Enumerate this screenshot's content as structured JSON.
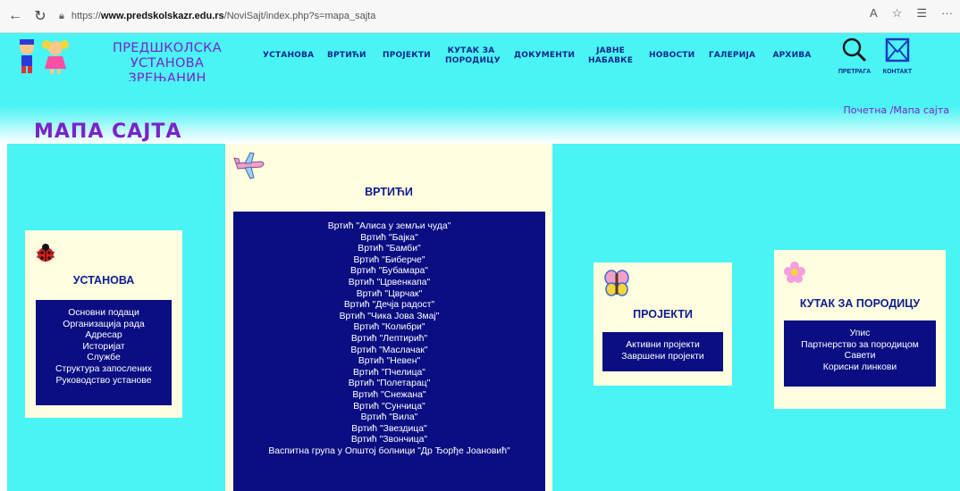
{
  "browser": {
    "url_prefix": "https://",
    "url_domain": "www.predskolskazr.edu.rs",
    "url_path": "/NoviSajt/index.php?s=mapa_sajta"
  },
  "header": {
    "brand_line1": "ПРЕДШКОЛСКА УСТАНОВА",
    "brand_line2": "ЗРЕЊАНИН",
    "menu": [
      {
        "line1": "УСТАНОВА",
        "line2": ""
      },
      {
        "line1": "ВРТИЋИ",
        "line2": ""
      },
      {
        "line1": "ПРОЈЕКТИ",
        "line2": ""
      },
      {
        "line1": "КУТАК ЗА",
        "line2": "ПОРОДИЦУ"
      },
      {
        "line1": "ДОКУМЕНТИ",
        "line2": ""
      },
      {
        "line1": "ЈАВНЕ",
        "line2": "НАБАВКЕ"
      },
      {
        "line1": "НОВОСТИ",
        "line2": ""
      },
      {
        "line1": "ГАЛЕРИЈА",
        "line2": ""
      },
      {
        "line1": "АРХИВА",
        "line2": ""
      }
    ],
    "search_label": "ПРЕТРАГА",
    "contact_label": "КОНТАКТ"
  },
  "page": {
    "title": "МАПА САЈТА",
    "breadcrumb_home": "Почетна",
    "breadcrumb_sep": " /",
    "breadcrumb_current": "Мапа сајта"
  },
  "sections": {
    "ustanova": {
      "title": "УСТАНОВА",
      "links": [
        "Основни подаци",
        "Организација рада",
        "Адресар",
        "Историјат",
        "Службе",
        "Структура запослених",
        "Руководство установе"
      ]
    },
    "vrtici": {
      "title": "ВРТИЋИ",
      "links": [
        "Вртић \"Алиса у земљи чуда\"",
        "Вртић \"Бајка\"",
        "Вртић \"Бамби\"",
        "Вртић \"Биберче\"",
        "Вртић \"Бубамара\"",
        "Вртић \"Црвенкапа\"",
        "Вртић \"Цврчак\"",
        "Вртић \"Дечја радост\"",
        "Вртић \"Чика Јова Змај\"",
        "Вртић \"Колибри\"",
        "Вртић \"Лептирић\"",
        "Вртић \"Маслачак\"",
        "Вртић \"Невен\"",
        "Вртић \"Пчелица\"",
        "Вртић \"Полетарац\"",
        "Вртић \"Снежана\"",
        "Вртић \"Сунчица\"",
        "Вртић \"Вила\"",
        "Вртић \"Звездица\"",
        "Вртић \"Звончица\"",
        "Васпитна група у Општој болници \"Др Ђорђе Јоановић\""
      ]
    },
    "projekti": {
      "title": "ПРОЈЕКТИ",
      "links": [
        "Активни пројекти",
        "Завршени пројекти"
      ]
    },
    "kutak": {
      "title": "КУТАК ЗА ПОРОДИЦУ",
      "links": [
        "Упис",
        "Партнерство за породицом",
        "Савети",
        "Корисни линкови"
      ]
    }
  },
  "colors": {
    "header_bg": "#4af3f4",
    "accent_purple": "#7a23c9",
    "menu_blue": "#102a8c",
    "link_box": "#0b0e82",
    "card_bg": "#fffde0"
  }
}
